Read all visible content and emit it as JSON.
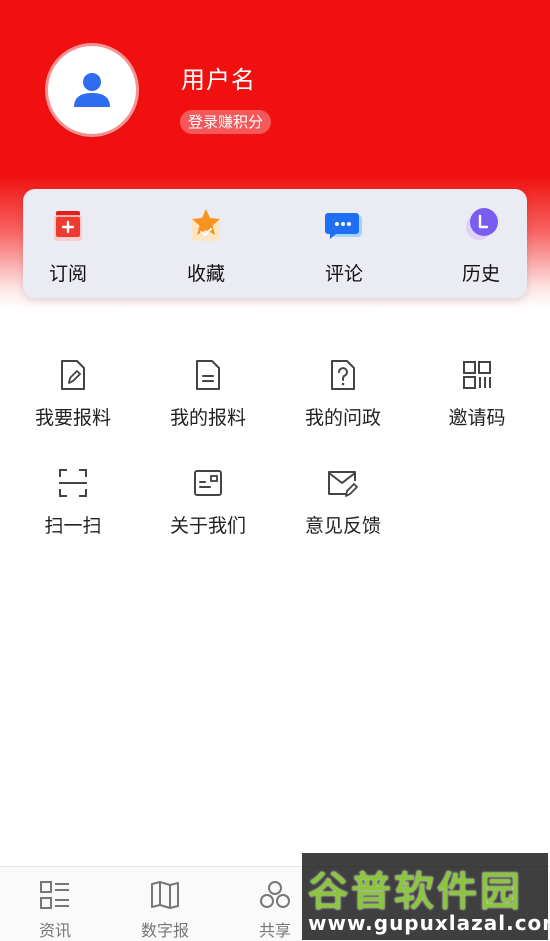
{
  "profile": {
    "username": "用户名",
    "login_prompt": "登录赚积分"
  },
  "quick_actions": [
    {
      "label": "订阅",
      "icon": "subscribe-icon"
    },
    {
      "label": "收藏",
      "icon": "star-favorite-icon"
    },
    {
      "label": "评论",
      "icon": "comment-bubble-icon"
    },
    {
      "label": "历史",
      "icon": "history-clock-icon"
    }
  ],
  "menu": [
    {
      "label": "我要报料",
      "icon": "edit-document-icon"
    },
    {
      "label": "我的报料",
      "icon": "document-icon"
    },
    {
      "label": "我的问政",
      "icon": "question-document-icon"
    },
    {
      "label": "邀请码",
      "icon": "qr-code-icon"
    },
    {
      "label": "扫一扫",
      "icon": "scan-icon"
    },
    {
      "label": "关于我们",
      "icon": "about-card-icon"
    },
    {
      "label": "意见反馈",
      "icon": "feedback-mail-icon"
    }
  ],
  "tabs": [
    {
      "label": "资讯",
      "icon": "news-list-icon"
    },
    {
      "label": "数字报",
      "icon": "digital-newspaper-icon"
    },
    {
      "label": "共享",
      "icon": "share-circles-icon"
    },
    {
      "label": "",
      "icon": "tab-icon-4"
    },
    {
      "label": "",
      "icon": "tab-icon-5"
    }
  ],
  "watermark": {
    "title": "谷普软件园",
    "url": "www.gupuxlazal.com"
  },
  "colors": {
    "brand_red": "#f01010",
    "avatar_blue": "#2f6df0",
    "tab_gray": "#777777"
  }
}
